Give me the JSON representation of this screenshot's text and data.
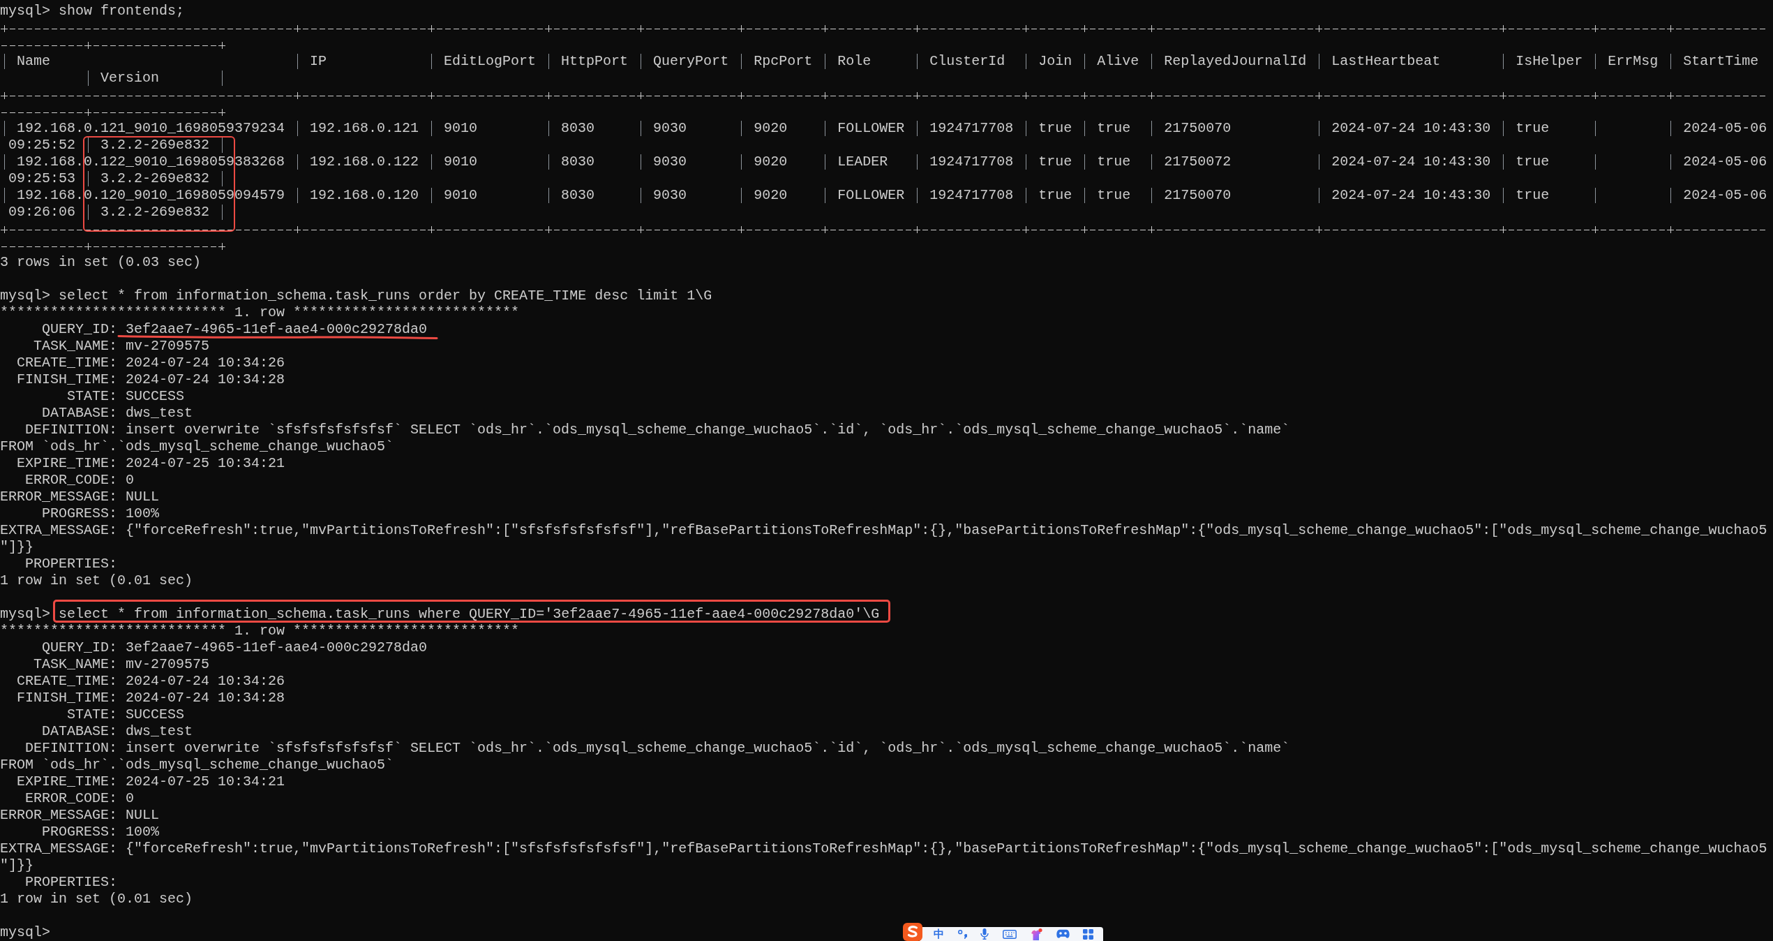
{
  "terminal": {
    "blocks": [
      {
        "kind": "command",
        "prompt": "mysql>",
        "text": "show frontends;",
        "boxed": false
      },
      {
        "kind": "table",
        "columns": [
          {
            "label": "Name",
            "boxed": false
          },
          {
            "label": "IP",
            "boxed": false
          },
          {
            "label": "EditLogPort",
            "boxed": false
          },
          {
            "label": "HttpPort",
            "boxed": false
          },
          {
            "label": "QueryPort",
            "boxed": false
          },
          {
            "label": "RpcPort",
            "boxed": false
          },
          {
            "label": "Role",
            "boxed": false
          },
          {
            "label": "ClusterId",
            "boxed": false
          },
          {
            "label": "Join",
            "boxed": false
          },
          {
            "label": "Alive",
            "boxed": false
          },
          {
            "label": "ReplayedJournalId",
            "boxed": false
          },
          {
            "label": "LastHeartbeat",
            "boxed": false
          },
          {
            "label": "IsHelper",
            "boxed": false
          },
          {
            "label": "ErrMsg",
            "boxed": false
          },
          {
            "label": "StartTime",
            "boxed": false
          }
        ],
        "wrapped_columns": [
          {
            "label": "Version",
            "boxed": true
          }
        ],
        "rows": [
          {
            "cells": [
              "192.168.0.121_9010_1698059379234",
              "192.168.0.121",
              "9010",
              "8030",
              "9030",
              "9020",
              "FOLLOWER",
              "1924717708",
              "true",
              "true",
              "21750070",
              "2024-07-24 10:43:30",
              "true",
              null,
              "2024-05-06"
            ],
            "wrap_lead": "09:25:52",
            "wrapped_cells": [
              "3.2.2-269e832"
            ]
          },
          {
            "cells": [
              "192.168.0.122_9010_1698059383268",
              "192.168.0.122",
              "9010",
              "8030",
              "9030",
              "9020",
              "LEADER",
              "1924717708",
              "true",
              "true",
              "21750072",
              "2024-07-24 10:43:30",
              "true",
              null,
              "2024-05-06"
            ],
            "wrap_lead": "09:25:53",
            "wrapped_cells": [
              "3.2.2-269e832"
            ]
          },
          {
            "cells": [
              "192.168.0.120_9010_1698059094579",
              "192.168.0.120",
              "9010",
              "8030",
              "9030",
              "9020",
              "FOLLOWER",
              "1924717708",
              "true",
              "true",
              "21750070",
              "2024-07-24 10:43:30",
              "true",
              null,
              "2024-05-06"
            ],
            "wrap_lead": "09:26:06",
            "wrapped_cells": [
              "3.2.2-269e832"
            ]
          }
        ]
      },
      {
        "kind": "status",
        "text": "3 rows in set (0.03 sec)"
      },
      {
        "kind": "command",
        "prompt": "mysql>",
        "text": "select * from information_schema.task_runs order by CREATE_TIME desc limit 1\\G",
        "boxed": false
      },
      {
        "kind": "record",
        "header": "*************************** 1. row ***************************",
        "fields": [
          {
            "key": "QUERY_ID:",
            "value": "3ef2aae7-4965-11ef-aae4-000c29278da0",
            "underlined": true
          },
          {
            "key": "TASK_NAME:",
            "value": "mv-2709575",
            "underlined": false
          },
          {
            "key": "CREATE_TIME:",
            "value": "2024-07-24 10:34:26",
            "underlined": false
          },
          {
            "key": "FINISH_TIME:",
            "value": "2024-07-24 10:34:28",
            "underlined": false
          },
          {
            "key": "STATE:",
            "value": "SUCCESS",
            "underlined": false
          },
          {
            "key": "DATABASE:",
            "value": "dws_test",
            "underlined": false
          },
          {
            "key": "DEFINITION:",
            "value": "insert overwrite `sfsfsfsfsfsfsf` SELECT `ods_hr`.`ods_mysql_scheme_change_wuchao5`.`id`, `ods_hr`.`ods_mysql_scheme_change_wuchao5`.`name`",
            "continuation": "FROM `ods_hr`.`ods_mysql_scheme_change_wuchao5`",
            "underlined": false
          },
          {
            "key": "EXPIRE_TIME:",
            "value": "2024-07-25 10:34:21",
            "underlined": false
          },
          {
            "key": "ERROR_CODE:",
            "value": "0",
            "underlined": false
          },
          {
            "key": "ERROR_MESSAGE:",
            "value": "NULL",
            "underlined": false
          },
          {
            "key": "PROGRESS:",
            "value": "100%",
            "underlined": false
          },
          {
            "key": "EXTRA_MESSAGE:",
            "value": "{\"forceRefresh\":true,\"mvPartitionsToRefresh\":[\"sfsfsfsfsfsfsf\"],\"refBasePartitionsToRefreshMap\":{},\"basePartitionsToRefreshMap\":{\"ods_mysql_scheme_change_wuchao5\":[\"ods_mysql_scheme_change_wuchao5",
            "continuation": "\"]}}",
            "underlined": false
          },
          {
            "key": "PROPERTIES:",
            "underlined": false
          }
        ]
      },
      {
        "kind": "status",
        "text": "1 row in set (0.01 sec)"
      },
      {
        "kind": "command",
        "prompt": "mysql>",
        "text": "select * from information_schema.task_runs where QUERY_ID='3ef2aae7-4965-11ef-aae4-000c29278da0'\\G",
        "boxed": true
      },
      {
        "kind": "record",
        "header": "*************************** 1. row ***************************",
        "fields": [
          {
            "key": "QUERY_ID:",
            "value": "3ef2aae7-4965-11ef-aae4-000c29278da0",
            "underlined": false
          },
          {
            "key": "TASK_NAME:",
            "value": "mv-2709575",
            "underlined": false
          },
          {
            "key": "CREATE_TIME:",
            "value": "2024-07-24 10:34:26",
            "underlined": false
          },
          {
            "key": "FINISH_TIME:",
            "value": "2024-07-24 10:34:28",
            "underlined": false
          },
          {
            "key": "STATE:",
            "value": "SUCCESS",
            "underlined": false
          },
          {
            "key": "DATABASE:",
            "value": "dws_test",
            "underlined": false
          },
          {
            "key": "DEFINITION:",
            "value": "insert overwrite `sfsfsfsfsfsfsf` SELECT `ods_hr`.`ods_mysql_scheme_change_wuchao5`.`id`, `ods_hr`.`ods_mysql_scheme_change_wuchao5`.`name`",
            "continuation": "FROM `ods_hr`.`ods_mysql_scheme_change_wuchao5`",
            "underlined": false
          },
          {
            "key": "EXPIRE_TIME:",
            "value": "2024-07-25 10:34:21",
            "underlined": false
          },
          {
            "key": "ERROR_CODE:",
            "value": "0",
            "underlined": false
          },
          {
            "key": "ERROR_MESSAGE:",
            "value": "NULL",
            "underlined": false
          },
          {
            "key": "PROGRESS:",
            "value": "100%",
            "underlined": false
          },
          {
            "key": "EXTRA_MESSAGE:",
            "value": "{\"forceRefresh\":true,\"mvPartitionsToRefresh\":[\"sfsfsfsfsfsfsf\"],\"refBasePartitionsToRefreshMap\":{},\"basePartitionsToRefreshMap\":{\"ods_mysql_scheme_change_wuchao5\":[\"ods_mysql_scheme_change_wuchao5",
            "continuation": "\"]}}",
            "underlined": false
          },
          {
            "key": "PROPERTIES:",
            "underlined": false
          }
        ]
      },
      {
        "kind": "status",
        "text": "1 row in set (0.01 sec)"
      },
      {
        "kind": "command",
        "prompt": "mysql>",
        "boxed": false
      }
    ]
  },
  "ime_toolbar": {
    "mode": "中"
  }
}
